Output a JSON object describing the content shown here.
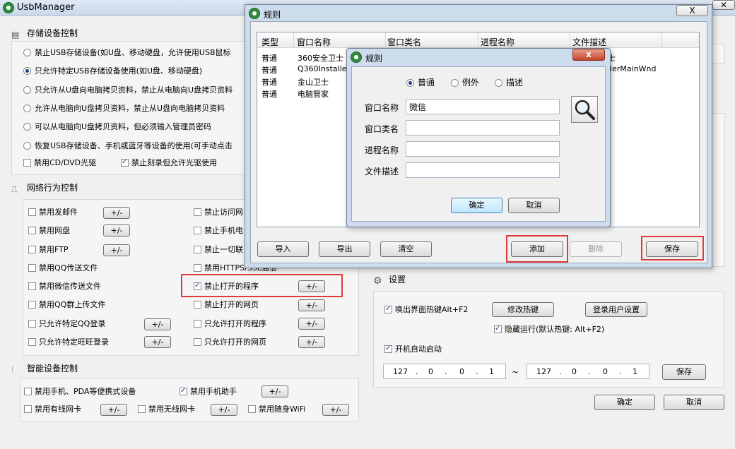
{
  "app": {
    "title": "UsbManager"
  },
  "storage": {
    "title": "存储设备控制",
    "options": [
      "禁止USB存储设备(如U盘、移动硬盘，允许使用USB鼠标",
      "只允许特定USB存储设备使用(如U盘、移动硬盘)",
      "只允许从U盘向电脑拷贝资料，禁止从电脑向U盘拷贝资料",
      "允许从电脑向U盘拷贝资料，禁止从U盘向电脑拷贝资料",
      "可以从电脑向U盘拷贝资料，但必须输入管理员密码",
      "恢复USB存储设备、手机或蓝牙等设备的使用(可手动点击"
    ],
    "cd_disable": "禁用CD/DVD光驱",
    "cd_burn": "禁止刻录但允许光驱使用"
  },
  "network": {
    "title": "网络行为控制",
    "pm": "+/-",
    "left": [
      "禁用发邮件",
      "禁用网盘",
      "禁用FTP",
      "禁用QQ传送文件",
      "禁用微信传送文件",
      "禁用QQ群上传文件",
      "只允许特定QQ登录",
      "只允许特定旺旺登录"
    ],
    "right": [
      "禁止访问网",
      "禁止手机电",
      "禁止一切联",
      "禁用HTTPS/SSL通信",
      "禁止打开的程序",
      "禁止打开的网页",
      "只允许打开的程序",
      "只允许打开的网页"
    ]
  },
  "smart": {
    "title": "智能设备控制",
    "pda": "禁用手机、PDA等便携式设备",
    "assistant": "禁用手机助手",
    "wired": "禁用有线网卡",
    "wireless": "禁用无线网卡",
    "wifi": "禁用随身WiFi"
  },
  "settings": {
    "title": "设置",
    "hotkey": "唤出界面热键Alt+F2",
    "modify_hotkey": "修改热键",
    "login_settings": "登录用户设置",
    "hidden": "隐藏运行(默认热键: Alt+F2)",
    "autostart": "开机自动启动",
    "ip_from": [
      "127",
      ".",
      "0",
      ".",
      "0",
      ".",
      "1"
    ],
    "tilde": "~",
    "ip_to": [
      "127",
      ".",
      "0",
      ".",
      "0",
      ".",
      "1"
    ],
    "save": "保存"
  },
  "footer": {
    "ok": "确定",
    "cancel": "取消"
  },
  "rules_dialog": {
    "title": "规则",
    "close": "X",
    "columns": [
      "类型",
      "窗口名称",
      "窗口类名",
      "进程名称",
      "文件描述"
    ],
    "rows": [
      [
        "普通",
        "360安全卫士",
        "",
        "",
        "士"
      ],
      [
        "普通",
        "Q360Installer",
        "",
        "",
        "llerMainWnd"
      ],
      [
        "普通",
        "金山卫士",
        "",
        "",
        ""
      ],
      [
        "普通",
        "电脑管家",
        "",
        "",
        ""
      ]
    ],
    "buttons": {
      "import": "导入",
      "export": "导出",
      "clear": "清空",
      "add": "添加",
      "delete": "删除",
      "save": "保存"
    }
  },
  "rule_edit": {
    "title": "规则",
    "close": "x",
    "radios": [
      "普通",
      "例外",
      "描述"
    ],
    "fields": {
      "window_name": {
        "label": "窗口名称",
        "value": "微信"
      },
      "window_class": {
        "label": "窗口类名",
        "value": ""
      },
      "process_name": {
        "label": "进程名称",
        "value": ""
      },
      "file_desc": {
        "label": "文件描述",
        "value": ""
      }
    },
    "ok": "确定",
    "cancel": "取消"
  },
  "colors": {
    "highlight": "#e03b3b",
    "accent": "#1b3a8c"
  }
}
